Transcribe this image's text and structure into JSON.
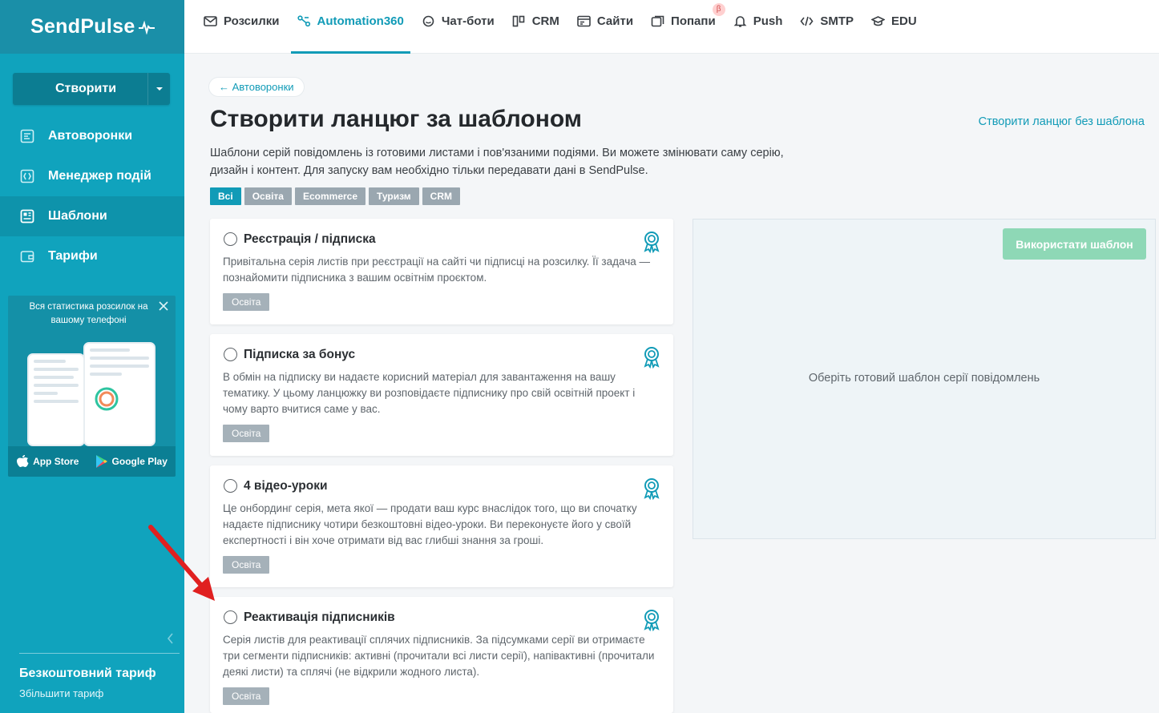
{
  "sidebar": {
    "logo": "SendPulse",
    "create_label": "Створити",
    "items": [
      {
        "label": "Автоворонки",
        "icon": "funnel-icon"
      },
      {
        "label": "Менеджер подій",
        "icon": "events-icon"
      },
      {
        "label": "Шаблони",
        "icon": "templates-icon",
        "active": true
      },
      {
        "label": "Тарифи",
        "icon": "wallet-icon"
      }
    ],
    "promo": {
      "text": "Вся статистика розсилок на вашому телефоні",
      "app_store": "App Store",
      "google_play": "Google Play"
    },
    "tariff": {
      "name": "Безкоштовний тариф",
      "link": "Збільшити тариф"
    }
  },
  "topnav": {
    "items": [
      {
        "label": "Розсилки",
        "icon": "mail-icon"
      },
      {
        "label": "Automation360",
        "icon": "automation-icon",
        "active": true
      },
      {
        "label": "Чат-боти",
        "icon": "chat-icon"
      },
      {
        "label": "CRM",
        "icon": "crm-icon"
      },
      {
        "label": "Сайти",
        "icon": "site-icon"
      },
      {
        "label": "Попапи",
        "icon": "popup-icon",
        "beta": "β"
      },
      {
        "label": "Push",
        "icon": "bell-icon"
      },
      {
        "label": "SMTP",
        "icon": "code-icon"
      },
      {
        "label": "EDU",
        "icon": "edu-icon"
      }
    ]
  },
  "main": {
    "breadcrumb": "← Автоворонки",
    "title": "Створити ланцюг за шаблоном",
    "no_template_link": "Створити ланцюг без шаблона",
    "description": "Шаблони серій повідомлень із готовими листами і пов'язаними подіями. Ви можете змінювати саму серію, дизайн і контент. Для запуску вам необхідно тільки передавати дані в SendPulse.",
    "filters": [
      {
        "label": "Всі",
        "active": true
      },
      {
        "label": "Освіта"
      },
      {
        "label": "Ecommerce"
      },
      {
        "label": "Туризм"
      },
      {
        "label": "CRM"
      }
    ],
    "templates": [
      {
        "title": "Реєстрація / підписка",
        "description": "Привітальна серія листів при реєстрації на сайті чи підписці на розсилку. Її задача — познайомити підписника з вашим освітнім проєктом.",
        "tag": "Освіта"
      },
      {
        "title": "Підписка за бонус",
        "description": "В обмін на підписку ви надаєте корисний матеріал для завантаження на вашу тематику. У цьому ланцюжку ви розповідаєте підписнику про свій освітній проект і чому варто вчитися саме у вас.",
        "tag": "Освіта"
      },
      {
        "title": "4 відео-уроки",
        "description": "Це онбординг серія, мета якої — продати ваш курс внаслідок того, що ви спочатку надаєте підписнику чотири безкоштовні відео-уроки. Ви переконуєте його у своїй експертності і він хоче отримати від вас глибші знання за гроші.",
        "tag": "Освіта"
      },
      {
        "title": "Реактивація підписників",
        "description": "Серія листів для реактивації сплячих підписників. За підсумками серії ви отримаєте три сегменти підписників: активні (прочитали всі листи серії), напівактивні (прочитали деякі листи) та сплячі (не відкрили жодного листа).",
        "tag": "Освіта"
      }
    ],
    "preview": {
      "use_button": "Використати шаблон",
      "placeholder": "Оберіть готовий шаблон серії повідомлень"
    }
  },
  "colors": {
    "sidebar": "#10a3bd",
    "accent": "#119bb7",
    "use_button": "#8ed8b6",
    "tag": "#a5b1b9",
    "arrow": "#e02020"
  }
}
